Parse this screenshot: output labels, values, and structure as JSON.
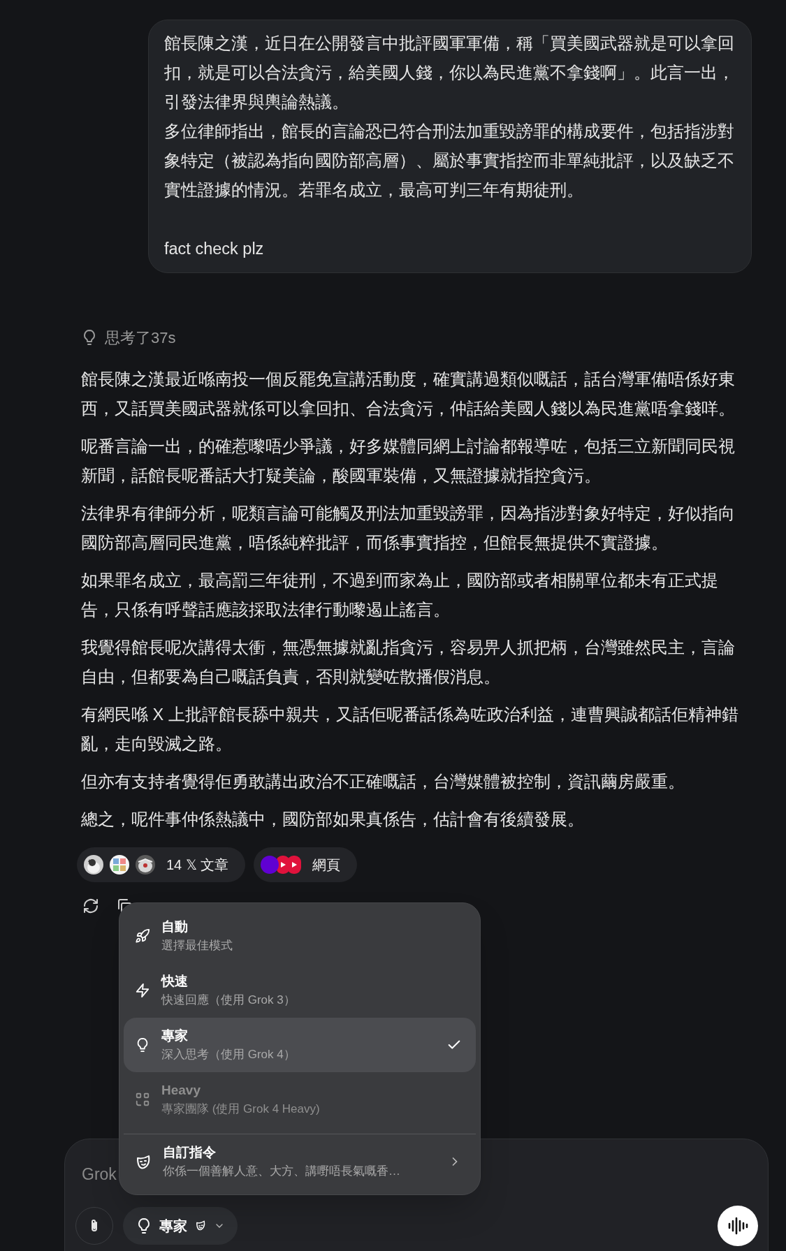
{
  "user_message": {
    "paragraphs": [
      "館長陳之漢，近日在公開發言中批評國軍軍備，稱「買美國武器就是可以拿回扣，就是可以合法貪污，給美國人錢，你以為民進黨不拿錢啊」。此言一出，引發法律界與輿論熱議。",
      "多位律師指出，館長的言論恐已符合刑法加重毀謗罪的構成要件，包括指涉對象特定（被認為指向國防部高層）、屬於事實指控而非單純批評，以及缺乏不實性證據的情況。若罪名成立，最高可判三年有期徒刑。",
      "fact check plz"
    ]
  },
  "response": {
    "thinking": "思考了37s",
    "paragraphs": [
      "館長陳之漢最近喺南投一個反罷免宣講活動度，確實講過類似嘅話，話台灣軍備唔係好東西，又話買美國武器就係可以拿回扣、合法貪污，仲話給美國人錢以為民進黨唔拿錢咩。",
      "呢番言論一出，的確惹嚟唔少爭議，好多媒體同網上討論都報導咗，包括三立新聞同民視新聞，話館長呢番話大打疑美論，酸國軍裝備，又無證據就指控貪污。",
      "法律界有律師分析，呢類言論可能觸及刑法加重毀謗罪，因為指涉對象好特定，好似指向國防部高層同民進黨，唔係純粹批評，而係事實指控，但館長無提供不實證據。",
      "如果罪名成立，最高罰三年徒刑，不過到而家為止，國防部或者相關單位都未有正式提告，只係有呼聲話應該採取法律行動嚟遏止謠言。",
      "我覺得館長呢次講得太衝，無憑無據就亂指貪污，容易畀人抓把柄，台灣雖然民主，言論自由，但都要為自己嘅話負責，否則就變咗散播假消息。",
      "有網民喺 X 上批評館長舔中親共，又話佢呢番話係為咗政治利益，連曹興誠都話佢精神錯亂，走向毀滅之路。",
      "但亦有支持者覺得佢勇敢講出政治不正確嘅話，台灣媒體被控制，資訊繭房嚴重。",
      "總之，呢件事仲係熱議中，國防部如果真係告，估計會有後續發展。"
    ],
    "sources": [
      {
        "kind": "posts",
        "label": "14 𝕏 文章"
      },
      {
        "kind": "web",
        "label": "網頁"
      }
    ]
  },
  "mode_menu": {
    "items": [
      {
        "title": "自動",
        "subtitle": "選擇最佳模式",
        "selected": false,
        "disabled": false
      },
      {
        "title": "快速",
        "subtitle": "快速回應（使用 Grok 3）",
        "selected": false,
        "disabled": false
      },
      {
        "title": "專家",
        "subtitle": "深入思考（使用 Grok 4）",
        "selected": true,
        "disabled": false
      },
      {
        "title": "Heavy",
        "subtitle": "專家團隊 (使用 Grok 4 Heavy)",
        "selected": false,
        "disabled": true
      }
    ],
    "custom_instructions": {
      "title": "自訂指令",
      "subtitle": "你係一個善解人意、大方、講嘢唔長氣嘅香…"
    }
  },
  "composer": {
    "placeholder": "Grok",
    "mode_button": "專家"
  }
}
